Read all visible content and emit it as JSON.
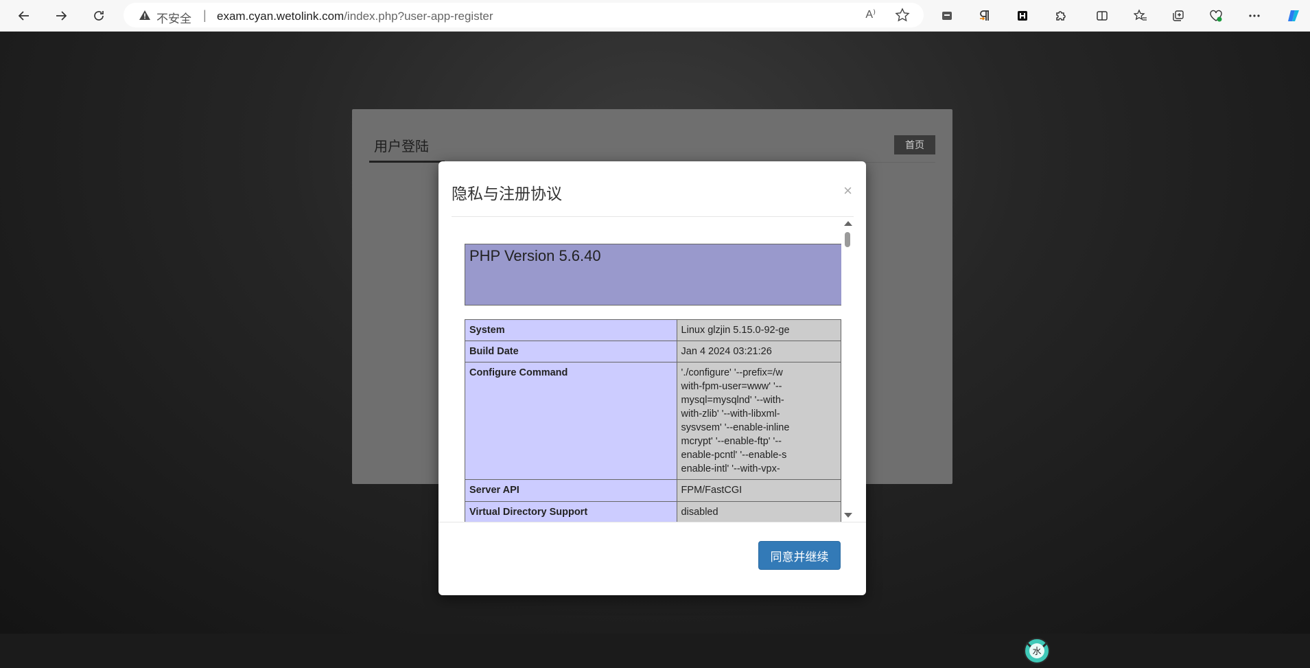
{
  "browser": {
    "security_label": "不安全",
    "url_host": "exam.cyan.wetolink.com",
    "url_path": "/index.php?user-app-register",
    "read_aloud_label": "A⁾",
    "icons": [
      "back-icon",
      "forward-icon",
      "refresh-icon",
      "warning-icon",
      "read-aloud-icon",
      "favorite-star-icon",
      "tab-actions-icon",
      "paragraph-extension-icon",
      "h-extension-icon",
      "extensions-icon",
      "split-screen-icon",
      "favorites-icon",
      "collections-icon",
      "health-icon",
      "more-icon",
      "copilot-icon"
    ]
  },
  "login": {
    "title": "用户登陆",
    "home_button": "首页"
  },
  "modal": {
    "title": "隐私与注册协议",
    "close_label": "×",
    "agree_button": "同意并继续",
    "phpinfo": {
      "version_title": "PHP Version 5.6.40",
      "rows": [
        {
          "key": "System",
          "value": "Linux glzjin 5.15.0-92-ge"
        },
        {
          "key": "Build Date",
          "value": "Jan 4 2024 03:21:26"
        },
        {
          "key": "Configure Command",
          "value_lines": [
            "'./configure' '--prefix=/w",
            "with-fpm-user=www' '--",
            "mysql=mysqlnd' '--with-",
            "with-zlib' '--with-libxml-",
            "sysvsem' '--enable-inline",
            "mcrypt' '--enable-ftp' '--",
            "enable-pcntl' '--enable-s",
            "enable-intl' '--with-vpx-"
          ]
        },
        {
          "key": "Server API",
          "value": "FPM/FastCGI"
        },
        {
          "key": "Virtual Directory Support",
          "value": "disabled"
        }
      ]
    }
  },
  "colors": {
    "php_header": "#9999cc",
    "php_key_cell": "#ccccff",
    "php_value_cell": "#cccccc",
    "agree_button": "#337ab7"
  }
}
